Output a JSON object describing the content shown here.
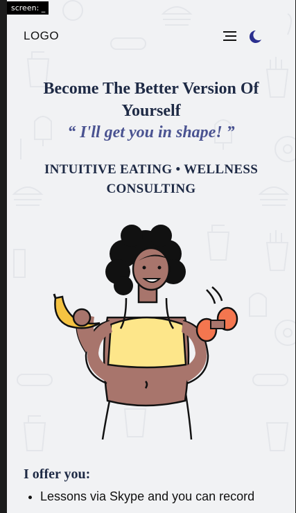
{
  "screen_tag": "screen: _",
  "header": {
    "logo": "LOGO",
    "menu_icon": "hamburger-menu-icon",
    "theme_icon": "moon-icon"
  },
  "hero": {
    "title": "Become The Better Version Of Yourself",
    "quote": "“ I'll get you in shape! ”",
    "tagline": "INTUITIVE EATING • WELLNESS CONSULTING"
  },
  "offer": {
    "heading": "I offer you:",
    "items": [
      "Lessons via Skype and you can record"
    ]
  },
  "colors": {
    "background": "#f1f2f4",
    "heading": "#1e2a45",
    "quote": "#4a5391",
    "moon": "#2b2f8f",
    "top_yellow": "#fde68a",
    "skin": "#a8756c",
    "banana": "#f5c342",
    "dumbbell": "#f4764f"
  }
}
